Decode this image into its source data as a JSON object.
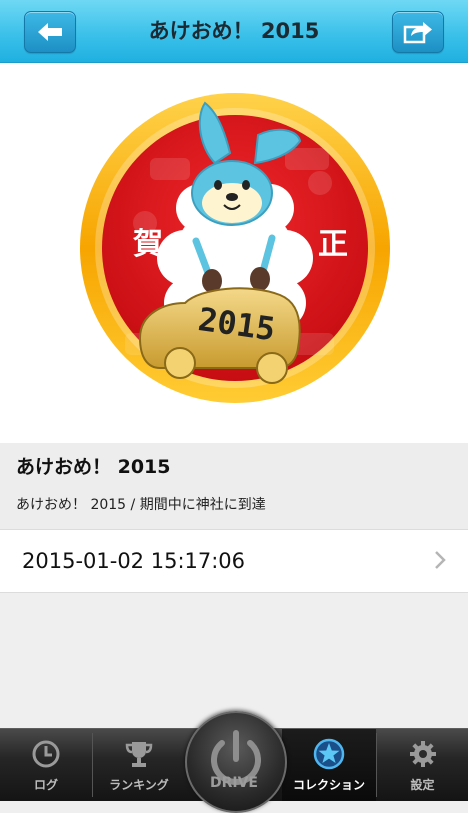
{
  "header": {
    "title": "あけおめ！ 2015",
    "back_icon": "arrow-left-icon",
    "share_icon": "share-arrow-icon"
  },
  "badge": {
    "left_char": "賀",
    "right_char": "正",
    "year_plate": "2015",
    "colors": {
      "ring": "#f7a500",
      "inner": "#e8151b",
      "sheep_ears": "#5cc3e0"
    }
  },
  "detail": {
    "title": "あけおめ！ 2015",
    "description": "あけおめ！ 2015 / 期間中に神社に到達"
  },
  "timestamp": {
    "value": "2015-01-02 15:17:06",
    "chevron_icon": "chevron-right-icon"
  },
  "tabbar": {
    "tabs": [
      {
        "label": "ログ",
        "icon": "clock-icon",
        "active": false
      },
      {
        "label": "ランキング",
        "icon": "trophy-icon",
        "active": false
      },
      {
        "label": "DRIVE",
        "icon": "power-icon",
        "active": false
      },
      {
        "label": "コレクション",
        "icon": "star-icon",
        "active": true
      },
      {
        "label": "設定",
        "icon": "gear-icon",
        "active": false
      }
    ]
  }
}
